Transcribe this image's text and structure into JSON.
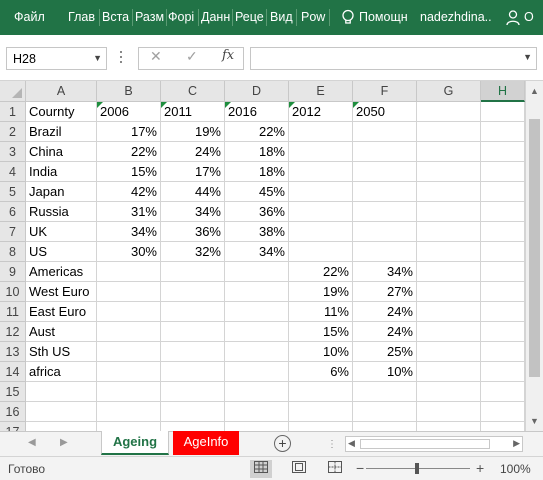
{
  "ribbon": {
    "tabs": [
      "Файл",
      "Глав",
      "Вста",
      "Разм",
      "Форі",
      "Данн",
      "Реце",
      "Вид",
      "Pow"
    ],
    "tell_me": "Помощн",
    "user": "nadezhdina...",
    "share": "О",
    "bg_color": "#217346"
  },
  "formula_bar": {
    "name_box": "H28",
    "formula_value": "",
    "fx_label": "fx",
    "cancel_symbol": "✕",
    "enter_symbol": "✓"
  },
  "columns": [
    "A",
    "B",
    "C",
    "D",
    "E",
    "F",
    "G",
    "H"
  ],
  "selected_column": "H",
  "rows": [
    {
      "n": "1",
      "cells": [
        "Cournty",
        "2006",
        "2011",
        "2016",
        "2012",
        "2050",
        "",
        ""
      ]
    },
    {
      "n": "2",
      "cells": [
        "Brazil",
        "17%",
        "19%",
        "22%",
        "",
        "",
        "",
        ""
      ]
    },
    {
      "n": "3",
      "cells": [
        "China",
        "22%",
        "24%",
        "18%",
        "",
        "",
        "",
        ""
      ]
    },
    {
      "n": "4",
      "cells": [
        "India",
        "15%",
        "17%",
        "18%",
        "",
        "",
        "",
        ""
      ]
    },
    {
      "n": "5",
      "cells": [
        "Japan",
        "42%",
        "44%",
        "45%",
        "",
        "",
        "",
        ""
      ]
    },
    {
      "n": "6",
      "cells": [
        "Russia",
        "31%",
        "34%",
        "36%",
        "",
        "",
        "",
        ""
      ]
    },
    {
      "n": "7",
      "cells": [
        "UK",
        "34%",
        "36%",
        "38%",
        "",
        "",
        "",
        ""
      ]
    },
    {
      "n": "8",
      "cells": [
        "US",
        "30%",
        "32%",
        "34%",
        "",
        "",
        "",
        ""
      ]
    },
    {
      "n": "9",
      "cells": [
        "Americas",
        "",
        "",
        "",
        "22%",
        "34%",
        "",
        ""
      ]
    },
    {
      "n": "10",
      "cells": [
        "West Euro",
        "",
        "",
        "",
        "19%",
        "27%",
        "",
        ""
      ]
    },
    {
      "n": "11",
      "cells": [
        "East Euro",
        "",
        "",
        "",
        "11%",
        "24%",
        "",
        ""
      ]
    },
    {
      "n": "12",
      "cells": [
        "Aust",
        "",
        "",
        "",
        "15%",
        "24%",
        "",
        ""
      ]
    },
    {
      "n": "13",
      "cells": [
        "Sth US",
        "",
        "",
        "",
        "10%",
        "25%",
        "",
        ""
      ]
    },
    {
      "n": "14",
      "cells": [
        "africa",
        "",
        "",
        "",
        "6%",
        "10%",
        "",
        ""
      ]
    },
    {
      "n": "15",
      "cells": [
        "",
        "",
        "",
        "",
        "",
        "",
        "",
        ""
      ]
    },
    {
      "n": "16",
      "cells": [
        "",
        "",
        "",
        "",
        "",
        "",
        "",
        ""
      ]
    },
    {
      "n": "17",
      "cells": [
        "",
        "",
        "",
        "",
        "",
        "",
        "",
        ""
      ]
    }
  ],
  "sheets": [
    {
      "name": "Ageing",
      "active": true
    },
    {
      "name": "AgeInfo",
      "active": false,
      "color": "#ff0000"
    }
  ],
  "add_sheet_symbol": "⊕",
  "status_bar": {
    "ready_text": "Готово",
    "zoom_minus": "−",
    "zoom_plus": "+",
    "zoom_level": "100%"
  }
}
